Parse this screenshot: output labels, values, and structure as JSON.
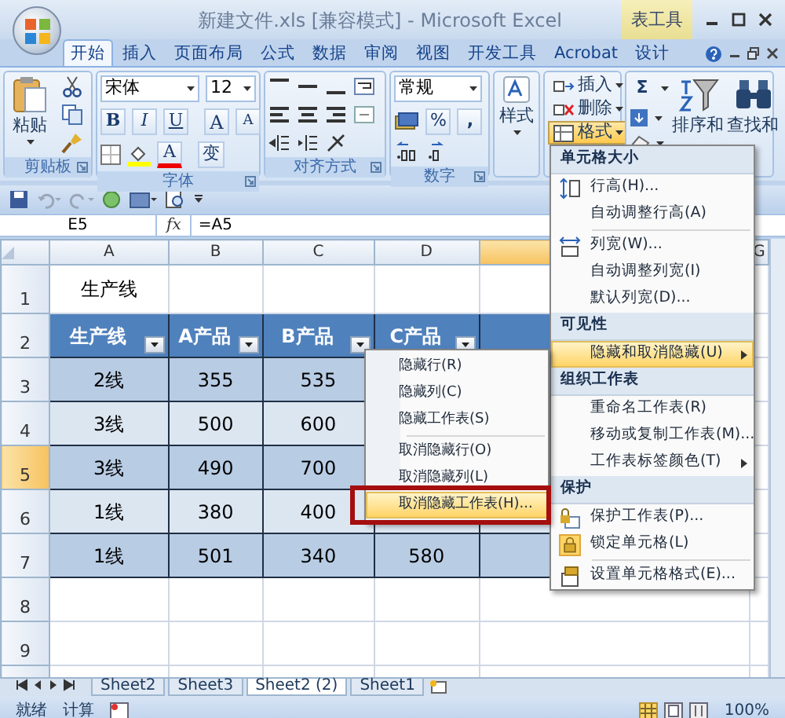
{
  "window": {
    "title": "新建文件.xls  [兼容模式] - Microsoft Excel",
    "context_group": "表工具"
  },
  "ribbon_tabs": [
    {
      "label": "开始",
      "selected": true
    },
    {
      "label": "插入",
      "selected": false
    },
    {
      "label": "页面布局",
      "selected": false
    },
    {
      "label": "公式",
      "selected": false
    },
    {
      "label": "数据",
      "selected": false
    },
    {
      "label": "审阅",
      "selected": false
    },
    {
      "label": "视图",
      "selected": false
    },
    {
      "label": "开发工具",
      "selected": false
    },
    {
      "label": "Acrobat",
      "selected": false
    },
    {
      "label": "设计",
      "selected": false
    }
  ],
  "ribbon": {
    "clipboard": {
      "title": "剪贴板",
      "paste": "粘贴"
    },
    "font": {
      "title": "字体",
      "face": "宋体",
      "size": "12",
      "bold": "B",
      "italic": "I",
      "underline": "U",
      "grow": "A",
      "shrink": "A",
      "font_color_label": "A",
      "phonetic": "变"
    },
    "alignment": {
      "title": "对齐方式"
    },
    "number": {
      "title": "数字",
      "format": "常规",
      "percent": "%",
      "comma": ","
    },
    "styles": {
      "label": "样式"
    },
    "cells": [
      {
        "label": "插入",
        "selected": false
      },
      {
        "label": "删除",
        "selected": false
      },
      {
        "label": "格式",
        "selected": true
      }
    ],
    "editing": {
      "sum": "Σ",
      "sort": "排序和",
      "find": "查找和"
    }
  },
  "formula_bar": {
    "name_box": "E5",
    "fx": "fx",
    "formula": "=A5"
  },
  "columns": [
    {
      "label": "A",
      "selected": false
    },
    {
      "label": "B",
      "selected": false
    },
    {
      "label": "C",
      "selected": false
    },
    {
      "label": "D",
      "selected": false
    },
    {
      "selected": true
    },
    {
      "label": "G",
      "selected": false
    }
  ],
  "rows": [
    {
      "number": "1",
      "selected": false,
      "kind": "title",
      "cells": [
        "生产线"
      ]
    },
    {
      "number": "2",
      "selected": false,
      "kind": "header",
      "cells": [
        "生产线",
        "A产品",
        "B产品",
        "C产品"
      ]
    },
    {
      "number": "3",
      "selected": false,
      "kind": "band",
      "cells": [
        "2线",
        "355",
        "535"
      ]
    },
    {
      "number": "4",
      "selected": false,
      "kind": "band",
      "cells": [
        "3线",
        "500",
        "600"
      ]
    },
    {
      "number": "5",
      "selected": true,
      "kind": "band",
      "cells": [
        "3线",
        "490",
        "700"
      ]
    },
    {
      "number": "6",
      "selected": false,
      "kind": "band",
      "cells": [
        "1线",
        "380",
        "400"
      ]
    },
    {
      "number": "7",
      "selected": false,
      "kind": "band",
      "cells": [
        "1线",
        "501",
        "340",
        "580"
      ]
    },
    {
      "number": "8",
      "selected": false,
      "kind": "empty"
    },
    {
      "number": "9",
      "selected": false,
      "kind": "empty"
    }
  ],
  "format_menu": [
    {
      "title": "单元格大小",
      "items": [
        {
          "kind": "item",
          "label": "行高(H)...",
          "selected": false,
          "submenu": false,
          "checked": false
        },
        {
          "kind": "item",
          "label": "自动调整行高(A)",
          "selected": false,
          "submenu": false,
          "checked": false
        },
        {
          "kind": "separator"
        },
        {
          "kind": "item",
          "label": "列宽(W)...",
          "selected": false,
          "submenu": false,
          "checked": false
        },
        {
          "kind": "item",
          "label": "自动调整列宽(I)",
          "selected": false,
          "submenu": false,
          "checked": false
        },
        {
          "kind": "item",
          "label": "默认列宽(D)...",
          "selected": false,
          "submenu": false,
          "checked": false
        }
      ]
    },
    {
      "title": "可见性",
      "items": [
        {
          "kind": "item",
          "label": "隐藏和取消隐藏(U)",
          "selected": true,
          "submenu": true,
          "checked": false
        }
      ]
    },
    {
      "title": "组织工作表",
      "items": [
        {
          "kind": "item",
          "label": "重命名工作表(R)",
          "selected": false,
          "submenu": false,
          "checked": false
        },
        {
          "kind": "item",
          "label": "移动或复制工作表(M)...",
          "selected": false,
          "submenu": false,
          "checked": false
        },
        {
          "kind": "item",
          "label": "工作表标签颜色(T)",
          "selected": false,
          "submenu": true,
          "checked": false
        }
      ]
    },
    {
      "title": "保护",
      "items": [
        {
          "kind": "item",
          "label": "保护工作表(P)...",
          "selected": false,
          "submenu": false,
          "checked": false
        },
        {
          "kind": "item",
          "label": "锁定单元格(L)",
          "selected": false,
          "submenu": false,
          "checked": true
        },
        {
          "kind": "separator"
        },
        {
          "kind": "item",
          "label": "设置单元格格式(E)...",
          "selected": false,
          "submenu": false,
          "checked": false
        }
      ]
    }
  ],
  "unhide_menu": [
    {
      "kind": "item",
      "label": "隐藏行(R)",
      "selected": false,
      "outlined": false
    },
    {
      "kind": "item",
      "label": "隐藏列(C)",
      "selected": false,
      "outlined": false
    },
    {
      "kind": "item",
      "label": "隐藏工作表(S)",
      "selected": false,
      "outlined": false
    },
    {
      "kind": "separator"
    },
    {
      "kind": "item",
      "label": "取消隐藏行(O)",
      "selected": false,
      "outlined": false
    },
    {
      "kind": "item",
      "label": "取消隐藏列(L)",
      "selected": false,
      "outlined": false
    },
    {
      "kind": "item",
      "label": "取消隐藏工作表(H)...",
      "selected": true,
      "outlined": true
    }
  ],
  "sheet_tabs": [
    {
      "label": "Sheet2",
      "selected": false
    },
    {
      "label": "Sheet3",
      "selected": false
    },
    {
      "label": "Sheet2 (2)",
      "selected": true
    },
    {
      "label": "Sheet1",
      "selected": false
    }
  ],
  "status_bar": {
    "ready": "就绪",
    "calc": "计算",
    "zoom": "100%"
  }
}
